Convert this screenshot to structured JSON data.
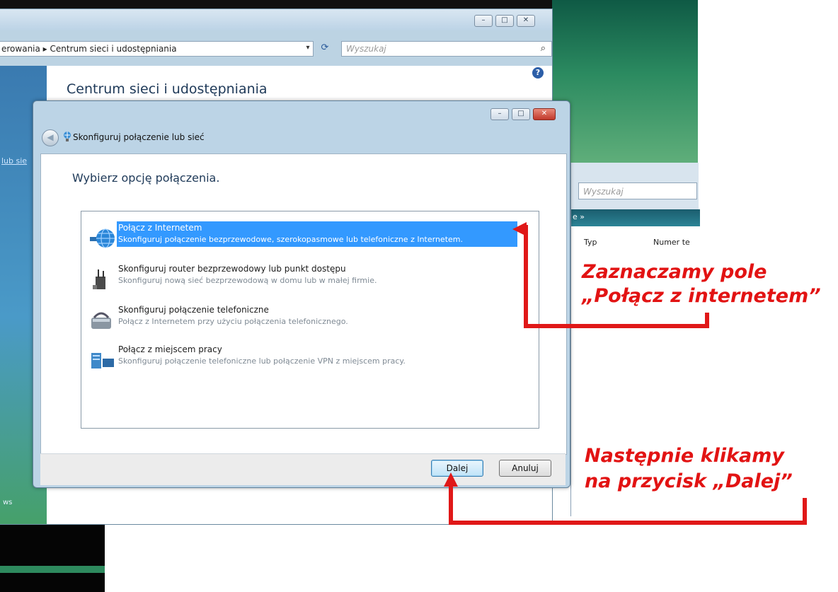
{
  "back_window": {
    "address": "erowania ▸ Centrum sieci i udostępniania",
    "search_placeholder": "Wyszukaj",
    "title": "Centrum sieci i udostępniania",
    "nav_link": "lub sie",
    "nav_footer": "ws",
    "caption_buttons": {
      "minimize": "–",
      "maximize": "□",
      "close": "✕"
    },
    "help_label": "?"
  },
  "right_window": {
    "search_placeholder": "Wyszukaj",
    "toolbar_label": "e  »",
    "col_type": "Typ",
    "col_number": "Numer te"
  },
  "dialog": {
    "title": "Skonfiguruj połączenie lub sieć",
    "heading": "Wybierz opcję połączenia.",
    "caption_buttons": {
      "minimize": "–",
      "maximize": "□",
      "close": "✕"
    },
    "back_label": "◀",
    "options": [
      {
        "title": "Połącz z Internetem",
        "desc": "Skonfiguruj połączenie bezprzewodowe, szerokopasmowe lub telefoniczne z Internetem.",
        "icon": "globe-icon",
        "selected": true
      },
      {
        "title": "Skonfiguruj router bezprzewodowy lub punkt dostępu",
        "desc": "Skonfiguruj nową sieć bezprzewodową w domu lub w małej firmie.",
        "icon": "wireless-router-icon",
        "selected": false
      },
      {
        "title": "Skonfiguruj połączenie telefoniczne",
        "desc": "Połącz z Internetem przy użyciu połączenia telefonicznego.",
        "icon": "dialup-modem-icon",
        "selected": false
      },
      {
        "title": "Połącz z miejscem pracy",
        "desc": "Skonfiguruj połączenie telefoniczne lub połączenie VPN z miejscem pracy.",
        "icon": "workplace-vpn-icon",
        "selected": false
      }
    ],
    "next_label": "Dalej",
    "cancel_label": "Anuluj"
  },
  "annotations": {
    "select_line1": "Zaznaczamy pole",
    "select_line2": "„Połącz z internetem”",
    "click_line1": "Następnie klikamy",
    "click_line2": "na przycisk „Dalej”",
    "color": "#e21313"
  },
  "colors": {
    "selection": "#3399ff",
    "heading_text": "#1e3958",
    "annotation": "#e21313"
  }
}
